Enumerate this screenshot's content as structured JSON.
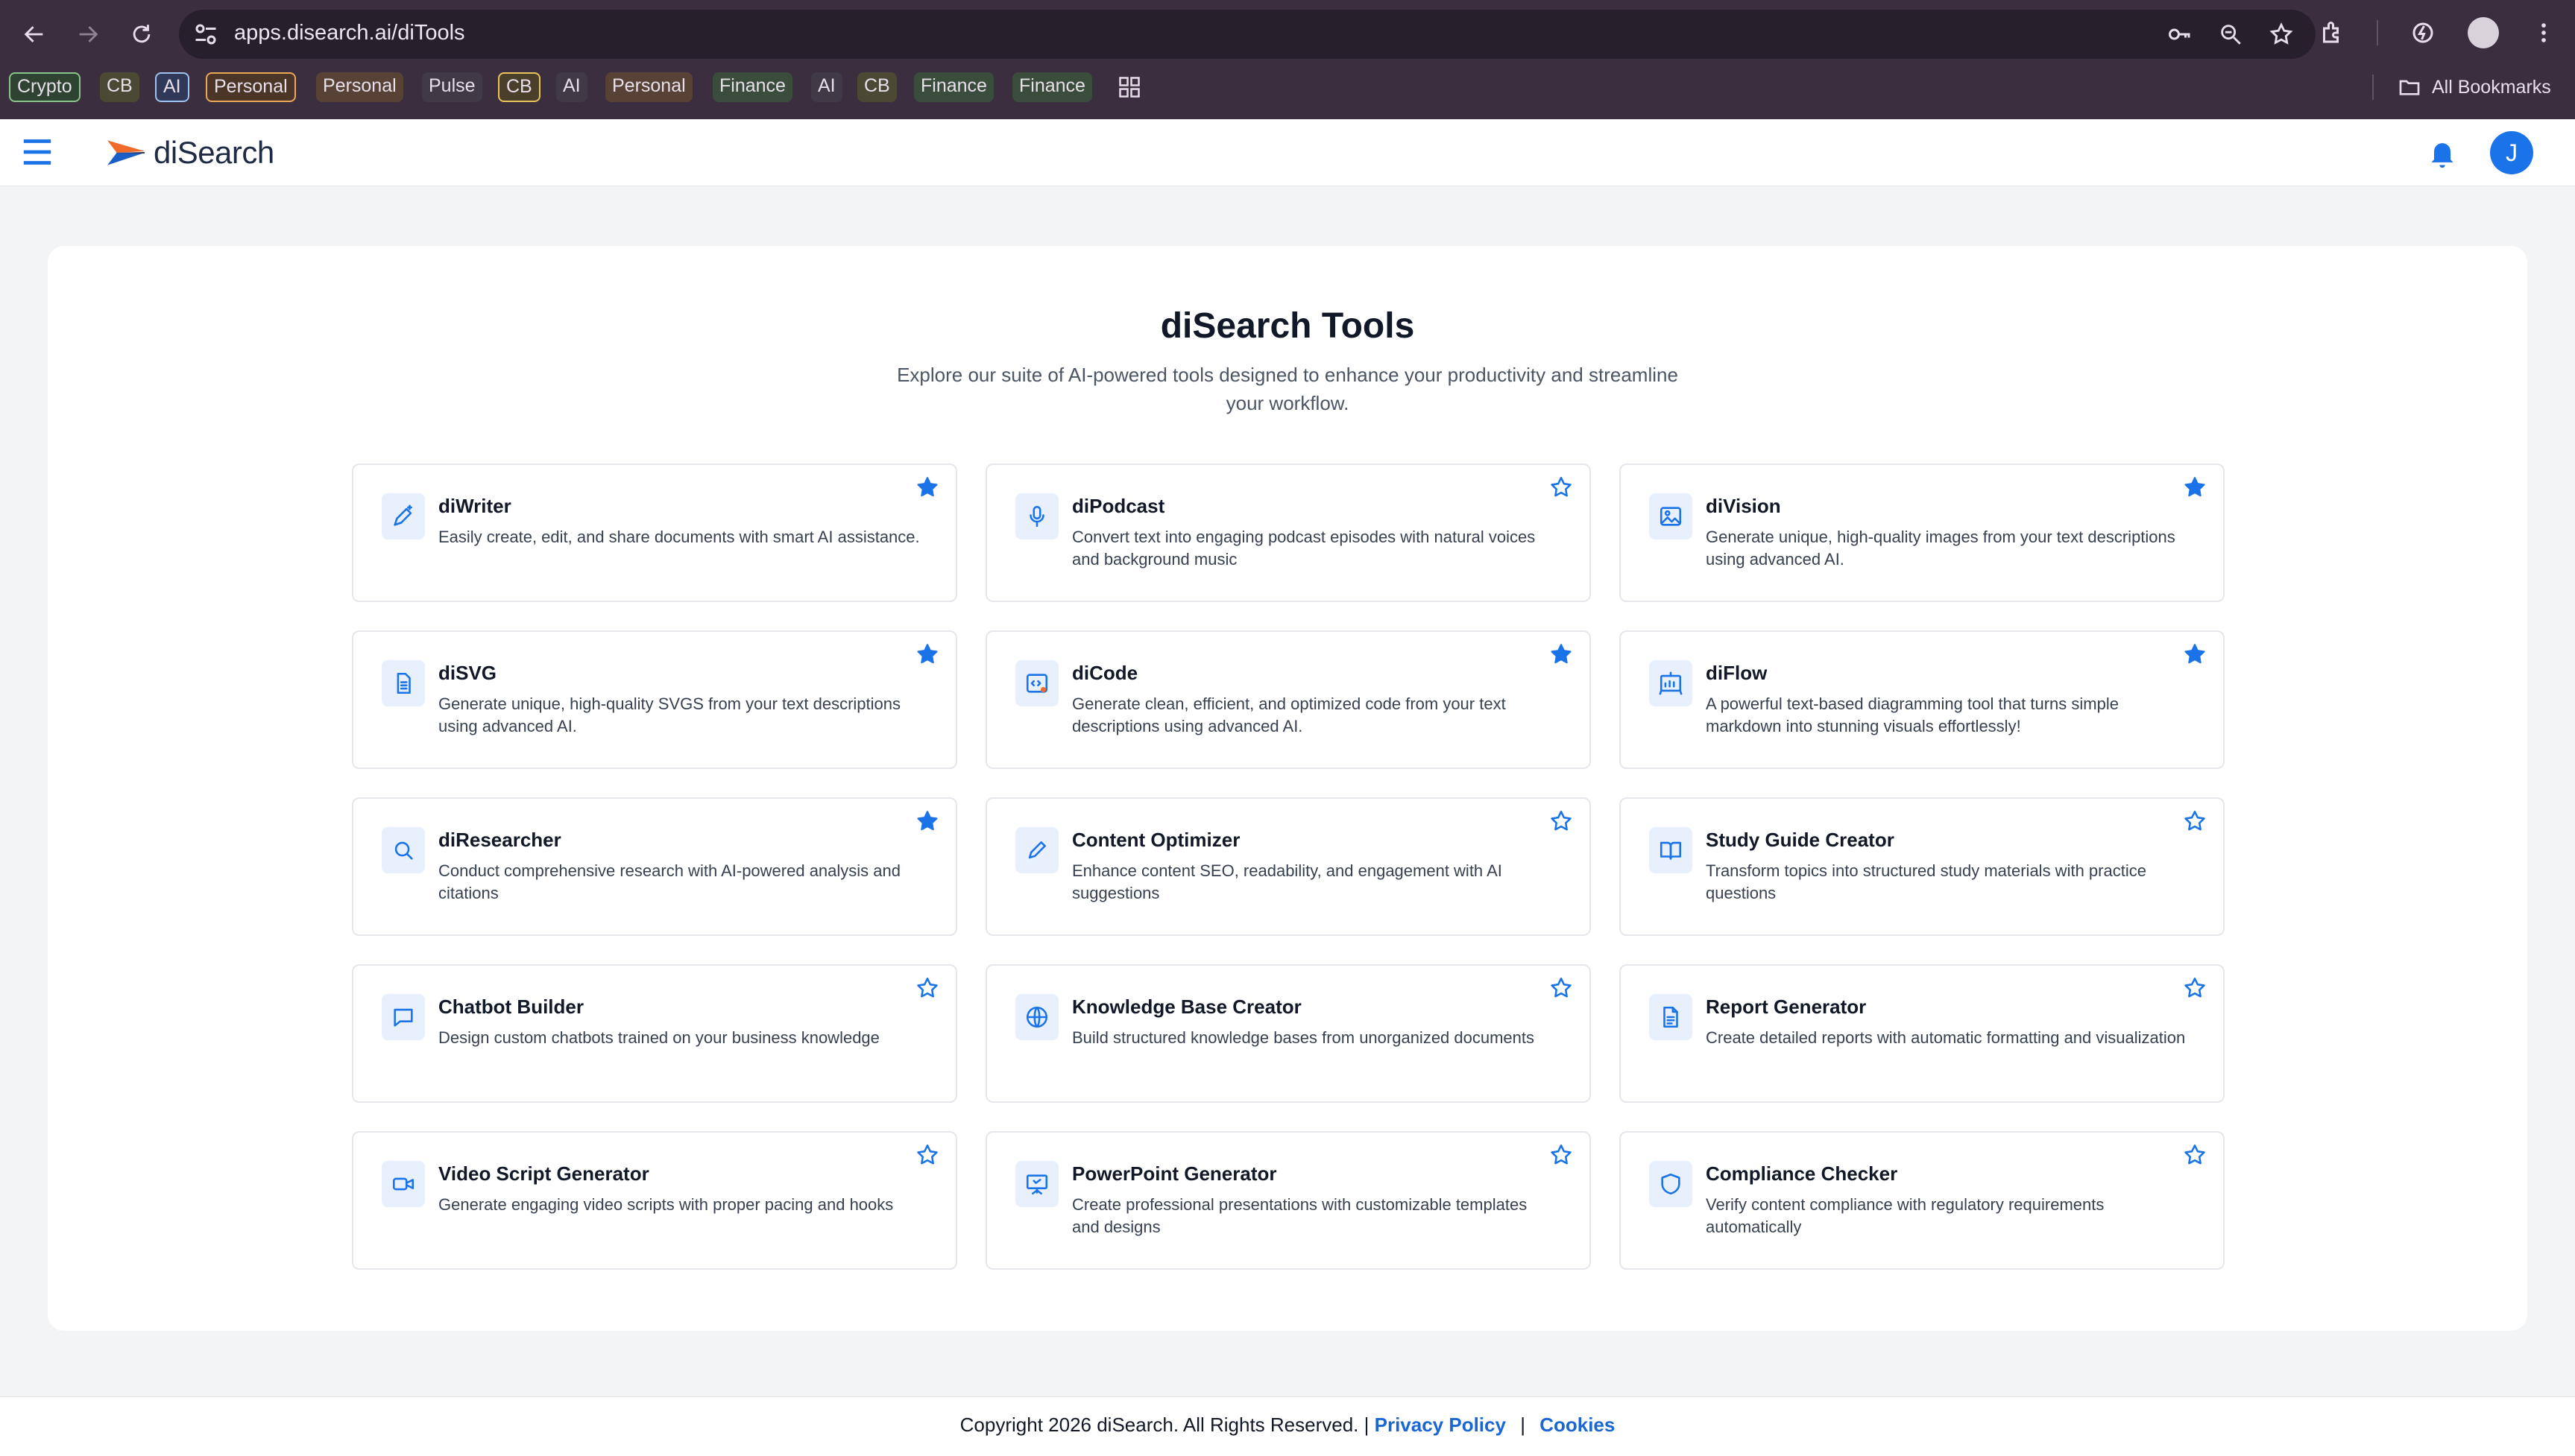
{
  "browser": {
    "url": "apps.disearch.ai/diTools",
    "bookmarks": [
      {
        "label": "Crypto",
        "style": "outlined green"
      },
      {
        "label": "CB",
        "style": "fill-olive"
      },
      {
        "label": "AI",
        "style": "outlined blue"
      },
      {
        "label": "Personal",
        "style": "outlined orange"
      },
      {
        "label": "Personal",
        "style": "fill-brown"
      },
      {
        "label": "Pulse",
        "style": "fill-dark"
      },
      {
        "label": "CB",
        "style": "outlined yellow"
      },
      {
        "label": "AI",
        "style": "fill-dark"
      },
      {
        "label": "Personal",
        "style": "fill-brown"
      },
      {
        "label": "Finance",
        "style": "fill-green"
      },
      {
        "label": "AI",
        "style": "fill-dark"
      },
      {
        "label": "CB",
        "style": "fill-olive"
      },
      {
        "label": "Finance",
        "style": "fill-green"
      },
      {
        "label": "Finance",
        "style": "fill-green"
      }
    ],
    "all_bookmarks_label": "All Bookmarks"
  },
  "header": {
    "logo_text": "diSearch",
    "user_initial": "J",
    "accent_color": "#1a73e8"
  },
  "main": {
    "title": "diSearch Tools",
    "subtitle": "Explore our suite of AI-powered tools designed to enhance your productivity and streamline your workflow.",
    "tools": [
      {
        "name": "diWriter",
        "description": "Easily create, edit, and share documents with smart AI assistance.",
        "icon": "pen-sparkle-icon",
        "favorite": true
      },
      {
        "name": "diPodcast",
        "description": "Convert text into engaging podcast episodes with natural voices and background music",
        "icon": "microphone-icon",
        "favorite": false
      },
      {
        "name": "diVision",
        "description": "Generate unique, high-quality images from your text descriptions using advanced AI.",
        "icon": "image-icon",
        "favorite": true
      },
      {
        "name": "diSVG",
        "description": "Generate unique, high-quality SVGS from your text descriptions using advanced AI.",
        "icon": "document-icon",
        "favorite": true
      },
      {
        "name": "diCode",
        "description": "Generate clean, efficient, and optimized code from your text descriptions using advanced AI.",
        "icon": "code-icon",
        "favorite": true
      },
      {
        "name": "diFlow",
        "description": "A powerful text-based diagramming tool that turns simple markdown into stunning visuals effortlessly!",
        "icon": "chart-board-icon",
        "favorite": true
      },
      {
        "name": "diResearcher",
        "description": "Conduct comprehensive research with AI-powered analysis and citations",
        "icon": "search-icon",
        "favorite": true
      },
      {
        "name": "Content Optimizer",
        "description": "Enhance content SEO, readability, and engagement with AI suggestions",
        "icon": "pencil-icon",
        "favorite": false
      },
      {
        "name": "Study Guide Creator",
        "description": "Transform topics into structured study materials with practice questions",
        "icon": "book-icon",
        "favorite": false
      },
      {
        "name": "Chatbot Builder",
        "description": "Design custom chatbots trained on your business knowledge",
        "icon": "chat-bubble-icon",
        "favorite": false
      },
      {
        "name": "Knowledge Base Creator",
        "description": "Build structured knowledge bases from unorganized documents",
        "icon": "globe-icon",
        "favorite": false
      },
      {
        "name": "Report Generator",
        "description": "Create detailed reports with automatic formatting and visualization",
        "icon": "file-text-icon",
        "favorite": false
      },
      {
        "name": "Video Script Generator",
        "description": "Generate engaging video scripts with proper pacing and hooks",
        "icon": "video-camera-icon",
        "favorite": false
      },
      {
        "name": "PowerPoint Generator",
        "description": "Create professional presentations with customizable templates and designs",
        "icon": "presentation-icon",
        "favorite": false
      },
      {
        "name": "Compliance Checker",
        "description": "Verify content compliance with regulatory requirements automatically",
        "icon": "shield-icon",
        "favorite": false
      }
    ]
  },
  "footer": {
    "copyright": "Copyright 2026 diSearch. All Rights Reserved. |",
    "privacy_label": "Privacy Policy",
    "separator": "|",
    "cookies_label": "Cookies"
  }
}
